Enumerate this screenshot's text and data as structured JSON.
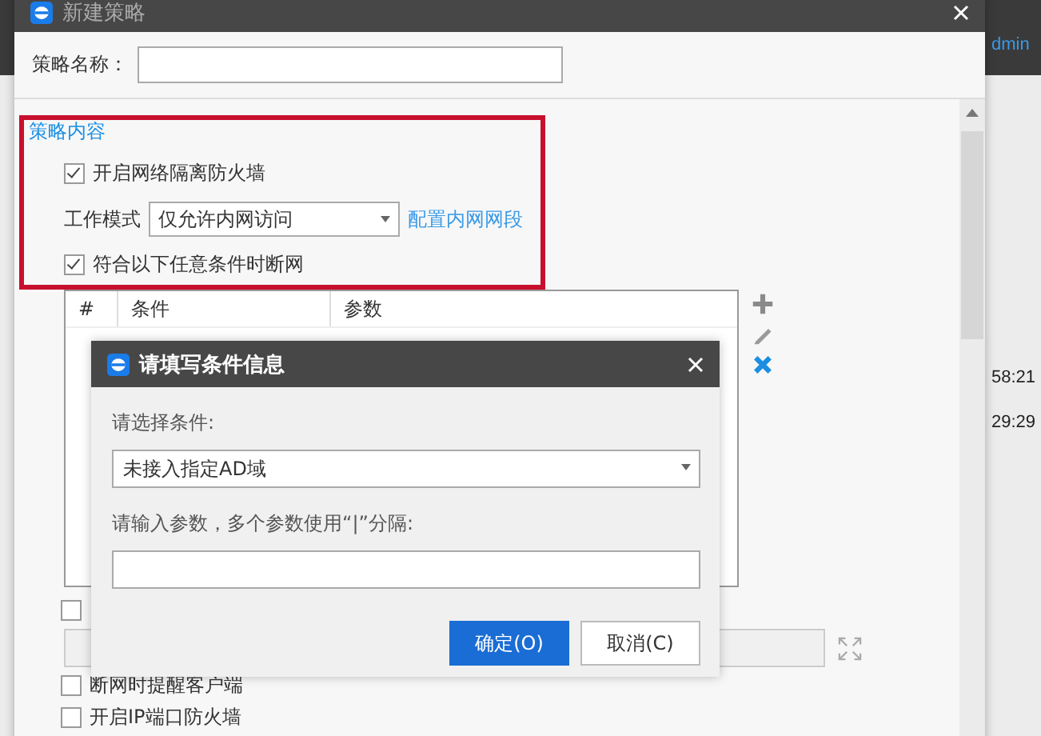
{
  "background_app": {
    "top_link": "dmin",
    "times": [
      "58:21",
      "29:29"
    ]
  },
  "window": {
    "title": "新建策略",
    "name_label": "策略名称："
  },
  "section": {
    "title": "策略内容",
    "firewall": {
      "label": "开启网络隔离防火墙",
      "checked": true
    },
    "mode": {
      "label": "工作模式",
      "value": "仅允许内网访问",
      "link": "配置内网网段"
    },
    "disconnect": {
      "label": "符合以下任意条件时断网",
      "checked": true
    }
  },
  "table": {
    "columns": [
      "#",
      "条件",
      "参数"
    ]
  },
  "hidden_option": {
    "checked": false
  },
  "options": [
    {
      "label": "断网时提醒客户端",
      "checked": false
    },
    {
      "label": "开启IP端口防火墙",
      "checked": false
    }
  ],
  "dialog": {
    "title": "请填写条件信息",
    "condition_label": "请选择条件:",
    "condition_value": "未接入指定AD域",
    "param_label": "请输入参数，多个参数使用“|”分隔:",
    "buttons": [
      {
        "label": "确定(O)",
        "kind": "primary"
      },
      {
        "label": "取消(C)",
        "kind": "secondary"
      }
    ]
  }
}
